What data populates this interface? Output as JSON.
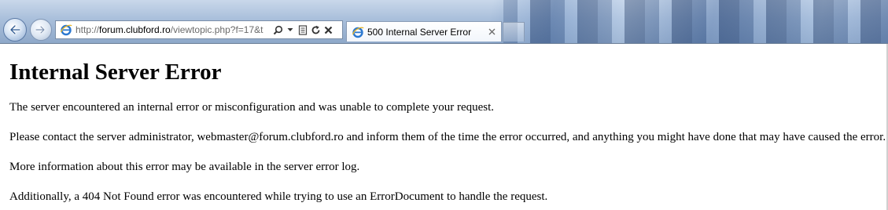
{
  "browser": {
    "address_bar": {
      "url_prefix": "http://",
      "url_host": "forum.clubford.ro",
      "url_path": "/viewtopic.php?f=17&t"
    },
    "tabs": [
      {
        "title": "500 Internal Server Error"
      }
    ],
    "icons": {
      "back": "back-arrow-icon",
      "forward": "forward-arrow-icon",
      "site": "ie-icon",
      "search": "search-icon",
      "dropdown": "chevron-down-icon",
      "compat": "compatibility-view-icon",
      "refresh": "refresh-icon",
      "stop": "stop-icon",
      "tab_close": "close-icon"
    }
  },
  "page": {
    "heading": "Internal Server Error",
    "paragraphs": [
      "The server encountered an internal error or misconfiguration and was unable to complete your request.",
      "Please contact the server administrator, webmaster@forum.clubford.ro and inform them of the time the error occurred, and anything you might have done that may have caused the error.",
      "More information about this error may be available in the server error log.",
      "Additionally, a 404 Not Found error was encountered while trying to use an ErrorDocument to handle the request."
    ]
  }
}
